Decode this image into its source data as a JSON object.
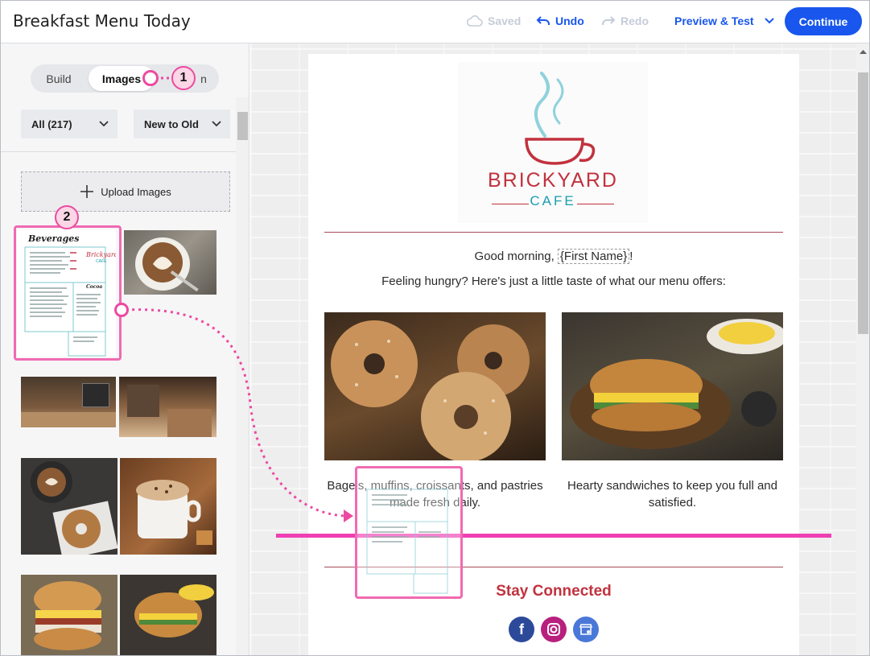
{
  "header": {
    "title": "Breakfast Menu Today",
    "saved": "Saved",
    "undo": "Undo",
    "redo": "Redo",
    "preview": "Preview & Test",
    "continue": "Continue"
  },
  "left_panel": {
    "tabs": [
      "Build",
      "Images",
      "Design"
    ],
    "visible_tab_fragment": "n",
    "selected_tab": "Images",
    "filter_all": "All (217)",
    "filter_sort": "New to Old",
    "upload_label": "Upload Images",
    "menu_thumb_title": "Beverages",
    "menu_thumb_logo": "Brickyard",
    "menu_thumb_logo_sub": "CAFE",
    "menu_thumb_section": "Cocoa"
  },
  "email": {
    "brand_line1": "BRICKYARD",
    "brand_line2": "CAFE",
    "greeting_prefix": "Good morning, ",
    "greeting_merge": "{First Name}",
    "greeting_suffix": "!",
    "intro": "Feeling hungry? Here's just a little taste of what our menu offers:",
    "caption_left": "Bagels, muffins, croissants, and pastries made fresh daily.",
    "caption_right": "Hearty sandwiches to keep you full and satisfied.",
    "stay_connected": "Stay Connected"
  },
  "annotations": {
    "badge1": "1",
    "badge2": "2"
  },
  "colors": {
    "accent": "#1856ed",
    "brand_red": "#c1323e",
    "brand_teal": "#1a9db0",
    "annotation_pink": "#ec4aa0"
  },
  "icons": [
    "cloud-icon",
    "undo-icon",
    "redo-icon",
    "chevron-down-icon",
    "plus-icon",
    "facebook-icon",
    "instagram-icon",
    "google-business-icon"
  ]
}
